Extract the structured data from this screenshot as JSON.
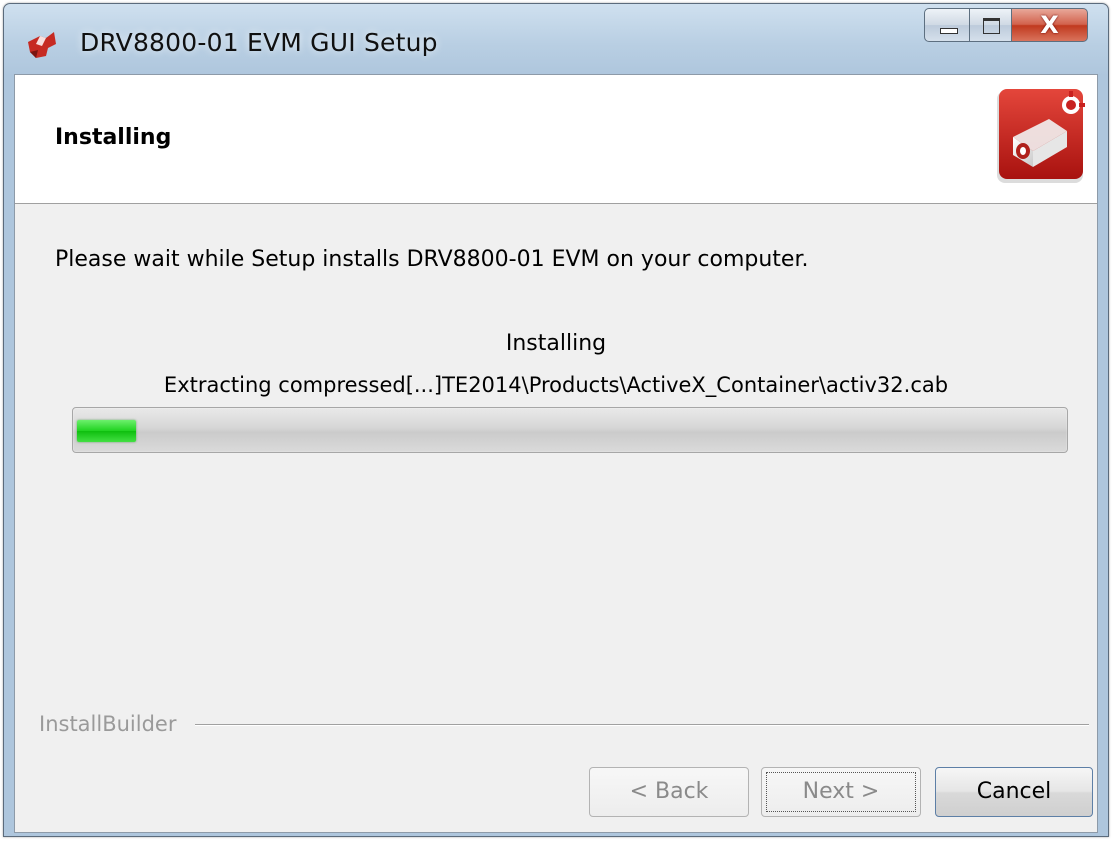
{
  "window": {
    "title": "DRV8800-01 EVM GUI Setup",
    "app_icon": "ti-logo-icon",
    "controls": [
      "minimize-icon",
      "maximize-icon",
      "close-icon"
    ],
    "close_glyph": "X"
  },
  "header": {
    "title": "Installing",
    "logo_icon": "installer-box-icon"
  },
  "body": {
    "description": "Please wait while Setup installs DRV8800-01 EVM on your computer.",
    "status_title": "Installing",
    "status_detail": "Extracting compressed[...]TE2014\\Products\\ActiveX_Container\\activ32.cab",
    "progress_percent": 6
  },
  "footer": {
    "brand": "InstallBuilder",
    "back_label": "< Back",
    "next_label": "Next >",
    "cancel_label": "Cancel"
  },
  "colors": {
    "progress_green": "#1fd21f",
    "brand_red": "#c8211f",
    "close_red": "#c0391f"
  }
}
